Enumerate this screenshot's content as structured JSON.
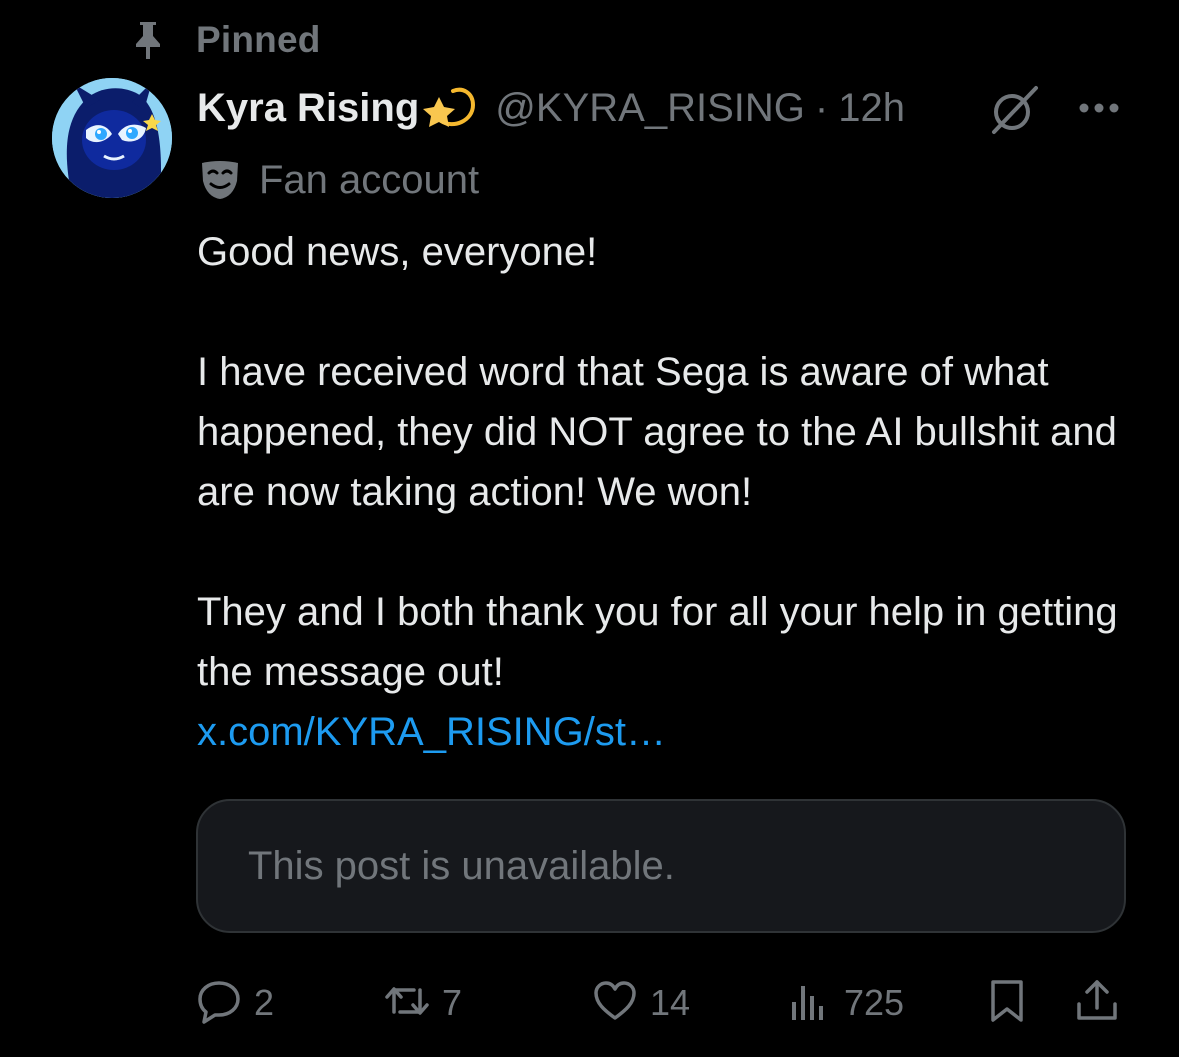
{
  "pinned": {
    "label": "Pinned",
    "icon": "pin-icon"
  },
  "author": {
    "display_name": "Kyra Rising",
    "name_emoji": "shooting-star-emoji",
    "handle": "@KYRA_RISING",
    "separator": "·",
    "timestamp": "12h",
    "label_icon": "theater-mask-icon",
    "label": "Fan account"
  },
  "header_actions": {
    "grok_icon": "grok-icon",
    "more_icon": "more-icon"
  },
  "post": {
    "paragraphs": [
      "Good news, everyone!",
      "I have received word that Sega is aware of what happened, they did NOT agree to the AI bullshit and are now taking action! We won!",
      "They and I both thank you for all your help in getting the message out!"
    ],
    "link": "x.com/KYRA_RISING/st…"
  },
  "quoted": {
    "unavailable_text": "This post is unavailable."
  },
  "actions": {
    "reply": {
      "icon": "reply-icon",
      "count": "2"
    },
    "repost": {
      "icon": "repost-icon",
      "count": "7"
    },
    "like": {
      "icon": "heart-icon",
      "count": "14"
    },
    "views": {
      "icon": "views-icon",
      "count": "725"
    },
    "bookmark": {
      "icon": "bookmark-icon"
    },
    "share": {
      "icon": "share-icon"
    }
  },
  "colors": {
    "background": "#000000",
    "text_primary": "#e7e9ea",
    "text_secondary": "#71767b",
    "link": "#1d9bf0",
    "card_background": "#16181c",
    "card_border": "#2f3336"
  }
}
